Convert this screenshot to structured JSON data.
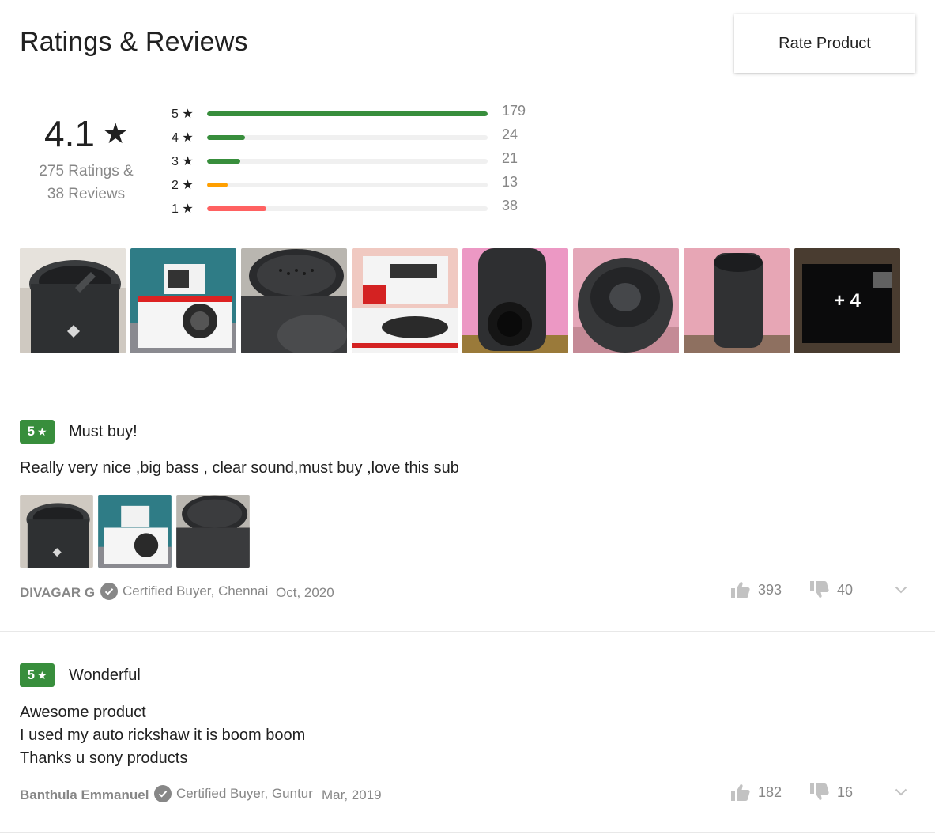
{
  "header": {
    "title": "Ratings & Reviews",
    "rate_button": "Rate Product"
  },
  "summary": {
    "average": "4.1",
    "star_glyph": "★",
    "ratings_line": "275 Ratings &",
    "reviews_line": "38 Reviews",
    "distribution": [
      {
        "label": "5 ★",
        "count": "179",
        "fraction": 1.0,
        "color": "#388e3c"
      },
      {
        "label": "4 ★",
        "count": "24",
        "fraction": 0.134,
        "color": "#388e3c"
      },
      {
        "label": "3 ★",
        "count": "21",
        "fraction": 0.117,
        "color": "#388e3c"
      },
      {
        "label": "2 ★",
        "count": "13",
        "fraction": 0.073,
        "color": "#ff9f00"
      },
      {
        "label": "1 ★",
        "count": "38",
        "fraction": 0.212,
        "color": "#ff6161"
      }
    ]
  },
  "gallery": {
    "more_label": "+ 4"
  },
  "reviews": [
    {
      "rating": "5",
      "star": "★",
      "title": "Must buy!",
      "body": [
        "Really very nice ,big bass , clear sound,must buy ,love this sub"
      ],
      "author": "DIVAGAR G",
      "certified": "Certified Buyer, Chennai",
      "date": "Oct, 2020",
      "likes": "393",
      "dislikes": "40"
    },
    {
      "rating": "5",
      "star": "★",
      "title": "Wonderful",
      "body": [
        "Awesome product",
        "I used my auto rickshaw it is boom boom",
        "Thanks u sony products"
      ],
      "author": "Banthula Emmanuel",
      "certified": "Certified Buyer, Guntur",
      "date": "Mar, 2019",
      "likes": "182",
      "dislikes": "16"
    }
  ],
  "colors": {
    "accent_green": "#388e3c",
    "muted_text": "#878787"
  },
  "icons": {
    "like": "thumbs-up-icon",
    "dislike": "thumbs-down-icon",
    "expand": "chevron-down-icon",
    "verified": "check-circle-icon"
  }
}
